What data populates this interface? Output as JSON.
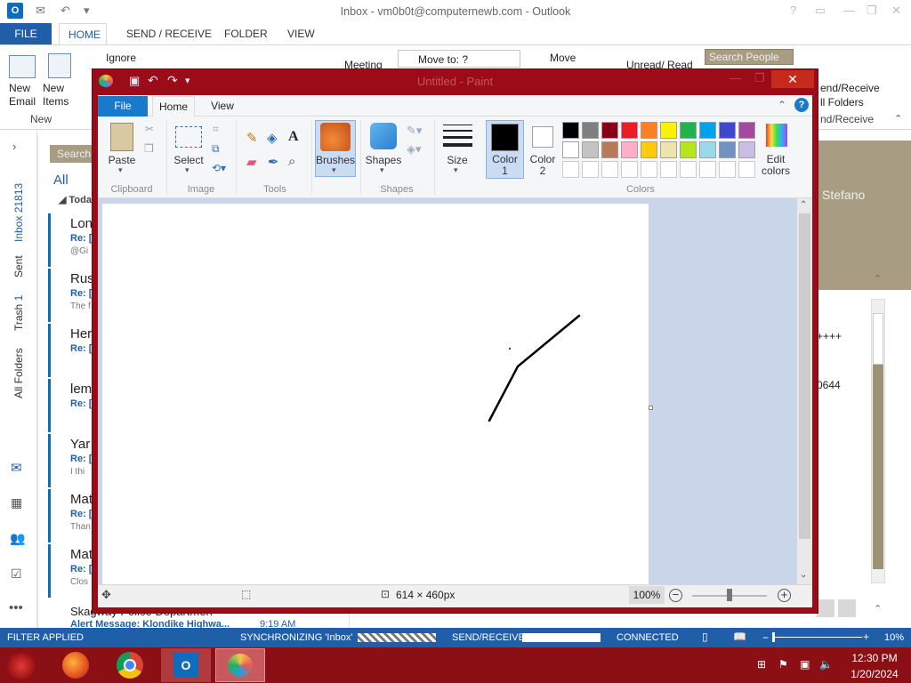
{
  "outlook": {
    "title": "Inbox - vm0b0t@computernewb.com - Outlook",
    "tabs": [
      "FILE",
      "HOME",
      "SEND / RECEIVE",
      "FOLDER",
      "VIEW"
    ],
    "ribbon": {
      "new_email": "New\nEmail",
      "new_items": "New\nItems",
      "group_new": "New",
      "ignore": "Ignore",
      "meeting": "Meeting",
      "move_to": "Move to: ?",
      "move": "Move",
      "unread_read": "Unread/ Read",
      "search_people": "Search People",
      "send_receive_all": "end/Receive",
      "all_folders": "ll Folders",
      "send_receive_group": "nd/Receive"
    },
    "nav": {
      "inbox": "Inbox",
      "inbox_count": "21813",
      "sent": "Sent",
      "trash": "Trash",
      "trash_count": "1",
      "all_folders": "All Folders"
    },
    "list": {
      "search_placeholder": "Search",
      "filter_all": "All",
      "group_today": "Toda",
      "items": [
        {
          "sender": "Lon",
          "sub": "Re: [",
          "prev": "@Gi"
        },
        {
          "sender": "Rus",
          "sub": "Re: [",
          "prev": "The f"
        },
        {
          "sender": "Her",
          "sub": "Re: [",
          "prev": ""
        },
        {
          "sender": "lem",
          "sub": "Re: [",
          "prev": ""
        },
        {
          "sender": "Yar",
          "sub": "Re: [",
          "prev": "I thi"
        },
        {
          "sender": "Mat",
          "sub": "Re: [",
          "prev": "Than"
        },
        {
          "sender": "Mat",
          "sub": "Re: [",
          "prev": "Clos"
        }
      ],
      "last_sender": "Skagway Police Departmen",
      "last_subject": "Alert Message: Klondike Highwa...",
      "last_time": "9:19 AM"
    },
    "reading": {
      "name": "Stefano",
      "line1": "++++",
      "line2": "0644"
    },
    "status": {
      "filter": "FILTER APPLIED",
      "sync": "SYNCHRONIZING 'Inbox'",
      "send_receive": "SEND/RECEIVE",
      "connected": "CONNECTED",
      "zoom": "10%"
    }
  },
  "taskbar": {
    "time": "12:30 PM",
    "date": "1/20/2024"
  },
  "paint": {
    "title": "Untitled - Paint",
    "tabs": {
      "file": "File",
      "home": "Home",
      "view": "View"
    },
    "clipboard": {
      "paste": "Paste",
      "label": "Clipboard"
    },
    "image": {
      "select": "Select",
      "label": "Image"
    },
    "tools": {
      "label": "Tools"
    },
    "brushes": "Brushes",
    "shapes": {
      "shapes": "Shapes",
      "label": "Shapes"
    },
    "size": "Size",
    "color1": "Color\n1",
    "color2": "Color\n2",
    "edit_colors": "Edit\ncolors",
    "colors_label": "Colors",
    "palette_row1": [
      "#000000",
      "#7f7f7f",
      "#880015",
      "#ed1c24",
      "#ff7f27",
      "#fff200",
      "#22b14c",
      "#00a2e8",
      "#3f48cc",
      "#a349a4"
    ],
    "palette_row2": [
      "#ffffff",
      "#c3c3c3",
      "#b97a57",
      "#ffaec9",
      "#ffc90e",
      "#efe4b0",
      "#b5e61d",
      "#99d9ea",
      "#7092be",
      "#c8bfe7"
    ],
    "status": {
      "size": "614 × 460px",
      "zoom": "100%"
    }
  }
}
